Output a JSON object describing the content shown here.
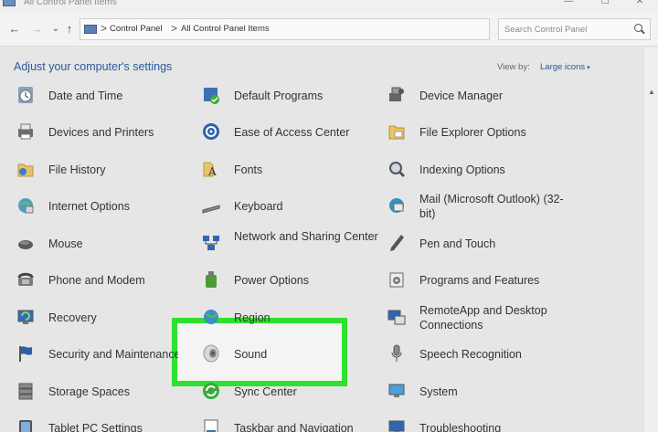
{
  "window": {
    "title": "All Control Panel Items",
    "controls": {
      "minimize": "—",
      "maximize": "☐",
      "close": "✕"
    }
  },
  "navigation": {
    "back": "←",
    "forward": "→",
    "recent": "⌄",
    "up": "↑",
    "breadcrumb": [
      "Control Panel",
      "All Control Panel Items"
    ],
    "separator": ">",
    "dropdown": "⌄",
    "refresh": "↻",
    "search_placeholder": "Search Control Panel"
  },
  "header": {
    "title": "Adjust your computer's settings",
    "view_by_label": "View by:",
    "view_by_value": "Large icons",
    "view_by_caret": "▾"
  },
  "items": {
    "col1": [
      {
        "label": "Date and Time",
        "icon": "clock-icon"
      },
      {
        "label": "Devices and Printers",
        "icon": "printer-icon"
      },
      {
        "label": "File History",
        "icon": "file-history-icon"
      },
      {
        "label": "Internet Options",
        "icon": "globe-icon"
      },
      {
        "label": "Mouse",
        "icon": "mouse-icon"
      },
      {
        "label": "Phone and Modem",
        "icon": "phone-icon"
      },
      {
        "label": "Recovery",
        "icon": "recovery-icon"
      },
      {
        "label": "Security and Maintenance",
        "icon": "flag-icon"
      },
      {
        "label": "Storage Spaces",
        "icon": "storage-icon"
      },
      {
        "label": "Tablet PC Settings",
        "icon": "tablet-icon"
      }
    ],
    "col2": [
      {
        "label": "Default Programs",
        "icon": "default-programs-icon"
      },
      {
        "label": "Ease of Access Center",
        "icon": "ease-of-access-icon"
      },
      {
        "label": "Fonts",
        "icon": "fonts-icon"
      },
      {
        "label": "Keyboard",
        "icon": "keyboard-icon"
      },
      {
        "label": "Network and Sharing Center",
        "icon": "network-icon"
      },
      {
        "label": "Power Options",
        "icon": "power-icon"
      },
      {
        "label": "Region",
        "icon": "region-icon"
      },
      {
        "label": "Sound",
        "icon": "speaker-icon"
      },
      {
        "label": "Sync Center",
        "icon": "sync-icon"
      },
      {
        "label": "Taskbar and Navigation",
        "icon": "taskbar-icon"
      }
    ],
    "col3": [
      {
        "label": "Device Manager",
        "icon": "device-manager-icon"
      },
      {
        "label": "File Explorer Options",
        "icon": "folder-icon"
      },
      {
        "label": "Indexing Options",
        "icon": "indexing-icon"
      },
      {
        "label": "Mail (Microsoft Outlook) (32-bit)",
        "icon": "mail-icon"
      },
      {
        "label": "Pen and Touch",
        "icon": "pen-icon"
      },
      {
        "label": "Programs and Features",
        "icon": "programs-icon"
      },
      {
        "label": "RemoteApp and Desktop Connections",
        "icon": "remote-desktop-icon"
      },
      {
        "label": "Speech Recognition",
        "icon": "microphone-icon"
      },
      {
        "label": "System",
        "icon": "system-icon"
      },
      {
        "label": "Troubleshooting",
        "icon": "troubleshooting-icon"
      }
    ]
  },
  "highlight": {
    "target": "Sound",
    "color": "#2fe02f"
  },
  "colors": {
    "link": "#2a5a9e",
    "background": "#e6e6e6"
  }
}
